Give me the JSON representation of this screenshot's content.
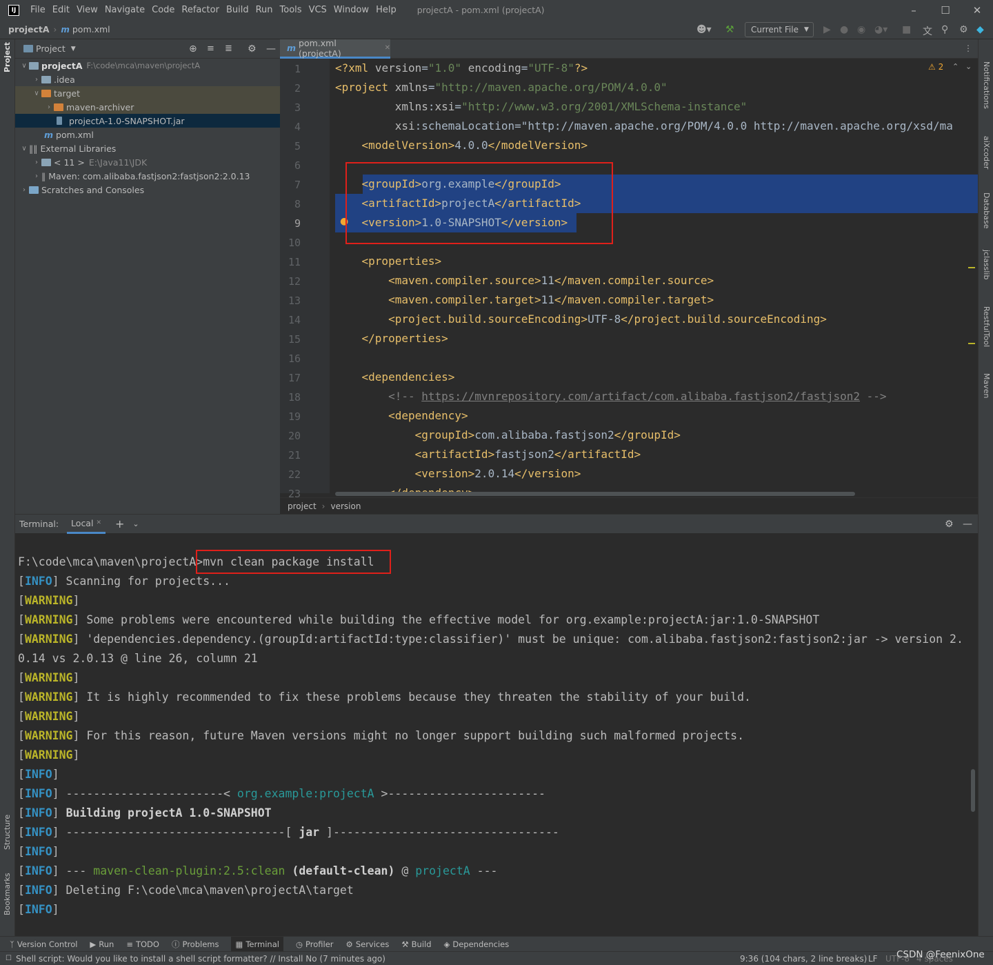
{
  "app": {
    "window_title": "projectA - pom.xml (projectA)",
    "menu": [
      "File",
      "Edit",
      "View",
      "Navigate",
      "Code",
      "Refactor",
      "Build",
      "Run",
      "Tools",
      "VCS",
      "Window",
      "Help"
    ]
  },
  "navbar": {
    "project": "projectA",
    "file": "pom.xml",
    "run_config": "Current File"
  },
  "project_panel": {
    "title": "Project",
    "tree": [
      {
        "label": "projectA",
        "path": "F:\\code\\mca\\maven\\projectA"
      },
      {
        "label": ".idea"
      },
      {
        "label": "target"
      },
      {
        "label": "maven-archiver"
      },
      {
        "label": "projectA-1.0-SNAPSHOT.jar"
      },
      {
        "label": "pom.xml"
      },
      {
        "label": "External Libraries"
      },
      {
        "label": "< 11 >",
        "path": "E:\\Java11\\JDK"
      },
      {
        "label": "Maven: com.alibaba.fastjson2:fastjson2:2.0.13"
      },
      {
        "label": "Scratches and Consoles"
      }
    ]
  },
  "editor": {
    "tab": "pom.xml (projectA)",
    "warning_count": "2",
    "line_numbers": [
      "1",
      "2",
      "3",
      "4",
      "5",
      "6",
      "7",
      "8",
      "9",
      "10",
      "11",
      "12",
      "13",
      "14",
      "15",
      "16",
      "17",
      "18",
      "19",
      "20",
      "21",
      "22",
      "23"
    ],
    "lines": [
      "<?xml version=\"1.0\" encoding=\"UTF-8\"?>",
      "<project xmlns=\"http://maven.apache.org/POM/4.0.0\"",
      "         xmlns:xsi=\"http://www.w3.org/2001/XMLSchema-instance\"",
      "         xsi:schemaLocation=\"http://maven.apache.org/POM/4.0.0 http://maven.apache.org/xsd/ma",
      "    <modelVersion>4.0.0</modelVersion>",
      "",
      "    <groupId>org.example</groupId>",
      "    <artifactId>projectA</artifactId>",
      "    <version>1.0-SNAPSHOT</version>",
      "",
      "    <properties>",
      "        <maven.compiler.source>11</maven.compiler.source>",
      "        <maven.compiler.target>11</maven.compiler.target>",
      "        <project.build.sourceEncoding>UTF-8</project.build.sourceEncoding>",
      "    </properties>",
      "",
      "    <dependencies>",
      "        <!-- https://mvnrepository.com/artifact/com.alibaba.fastjson2/fastjson2 -->",
      "        <dependency>",
      "            <groupId>com.alibaba.fastjson2</groupId>",
      "            <artifactId>fastjson2</artifactId>",
      "            <version>2.0.14</version>",
      "        </dependency>"
    ],
    "breadcrumb": [
      "project",
      "version"
    ]
  },
  "terminal": {
    "title": "Terminal:",
    "tab": "Local",
    "lines": [
      "F:\\code\\mca\\maven\\projectA>mvn clean package install",
      "[INFO] Scanning for projects...",
      "[WARNING]",
      "[WARNING] Some problems were encountered while building the effective model for org.example:projectA:jar:1.0-SNAPSHOT",
      "[WARNING] 'dependencies.dependency.(groupId:artifactId:type:classifier)' must be unique: com.alibaba.fastjson2:fastjson2:jar -> version 2.",
      "0.14 vs 2.0.13 @ line 26, column 21",
      "[WARNING]",
      "[WARNING] It is highly recommended to fix these problems because they threaten the stability of your build.",
      "[WARNING]",
      "[WARNING] For this reason, future Maven versions might no longer support building such malformed projects.",
      "[WARNING]",
      "[INFO]",
      "[INFO] -----------------------< org.example:projectA >-----------------------",
      "[INFO] Building projectA 1.0-SNAPSHOT",
      "[INFO] --------------------------------[ jar ]---------------------------------",
      "[INFO]",
      "[INFO] --- maven-clean-plugin:2.5:clean (default-clean) @ projectA ---",
      "[INFO] Deleting F:\\code\\mca\\maven\\projectA\\target",
      "[INFO]"
    ]
  },
  "left_strip": [
    "Project",
    "Structure",
    "Bookmarks"
  ],
  "right_strip": [
    "Notifications",
    "aiXcoder",
    "Database",
    "jclasslib",
    "RestfulTool",
    "Maven"
  ],
  "bottom_tools": [
    "Version Control",
    "Run",
    "TODO",
    "Problems",
    "Terminal",
    "Profiler",
    "Services",
    "Build",
    "Dependencies"
  ],
  "status": {
    "message": "Shell script: Would you like to install a shell script formatter? // Install   No (7 minutes ago)",
    "position": "9:36 (104 chars, 2 line breaks)",
    "line_sep": "LF",
    "encoding": "UTF-8",
    "indent": "4 spaces",
    "watermark": "CSDN @FeenixOne"
  }
}
